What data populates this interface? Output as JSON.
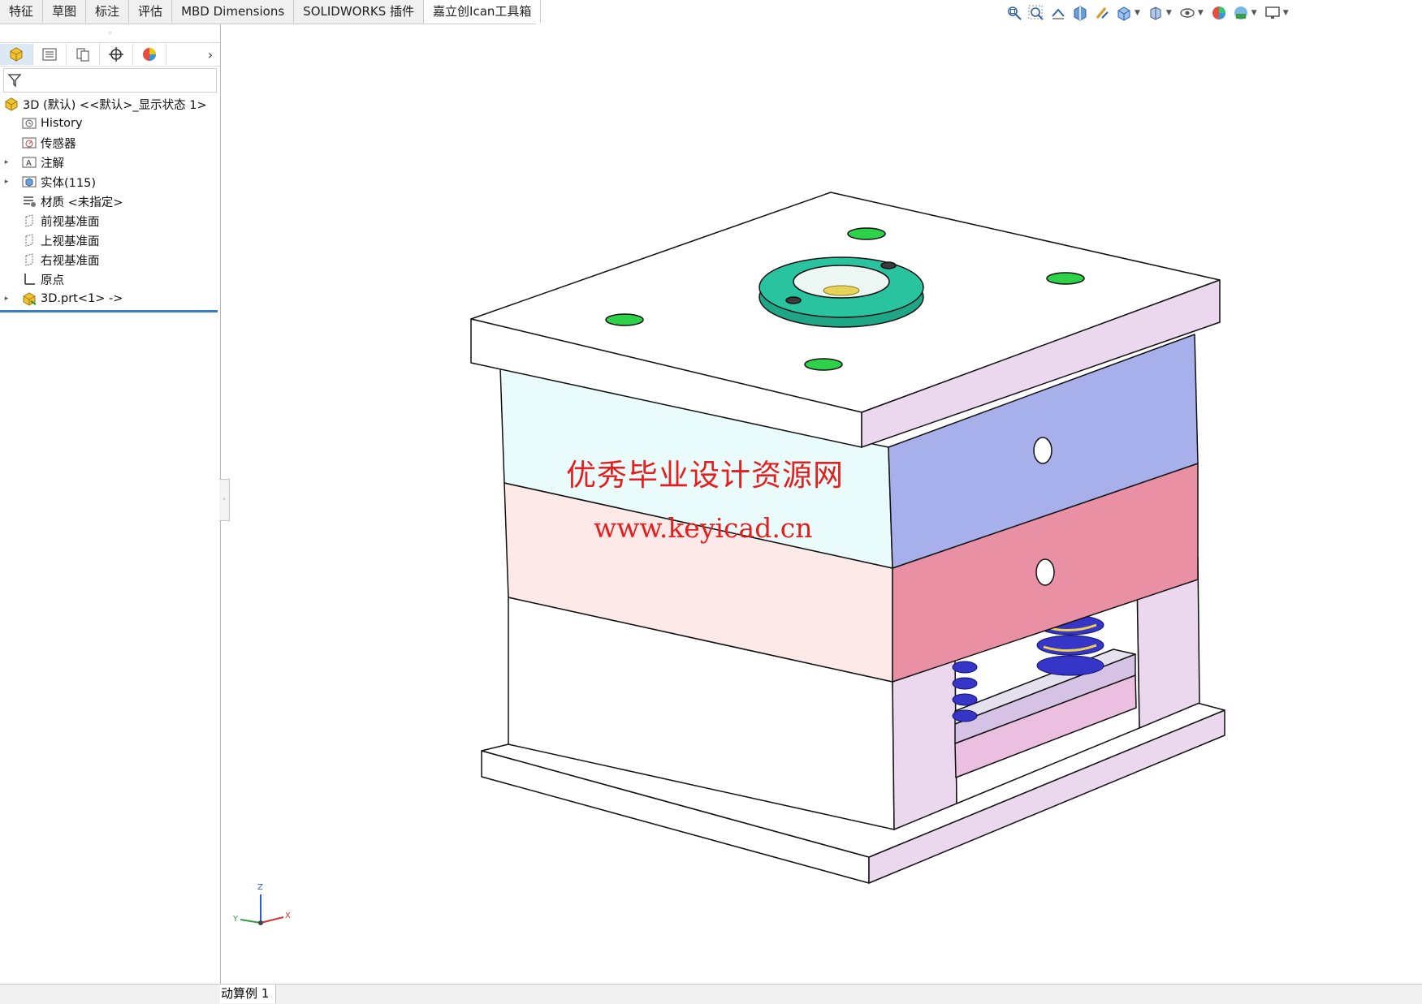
{
  "tabs": [
    {
      "label": "特征"
    },
    {
      "label": "草图"
    },
    {
      "label": "标注"
    },
    {
      "label": "评估"
    },
    {
      "label": "MBD Dimensions"
    },
    {
      "label": "SOLIDWORKS 插件"
    },
    {
      "label": "嘉立创Ican工具箱"
    }
  ],
  "view_toolbar": {
    "icons": [
      "zoom-to-fit-icon",
      "zoom-to-area-icon",
      "previous-view-icon",
      "section-view-icon",
      "dynamic-annotation-icon",
      "view-orientation-icon",
      "display-style-icon",
      "hide-show-items-icon",
      "edit-appearance-icon",
      "apply-scene-icon",
      "view-settings-icon"
    ]
  },
  "feature_tree": {
    "root": "3D (默认) <<默认>_显示状态 1>",
    "items": [
      {
        "label": "History",
        "icon": "history-icon",
        "expandable": false
      },
      {
        "label": "传感器",
        "icon": "sensor-icon",
        "expandable": false
      },
      {
        "label": "注解",
        "icon": "annotation-icon",
        "expandable": true
      },
      {
        "label": "实体(115)",
        "icon": "solid-bodies-icon",
        "expandable": true
      },
      {
        "label": "材质 <未指定>",
        "icon": "material-icon",
        "expandable": false
      },
      {
        "label": "前视基准面",
        "icon": "plane-icon",
        "expandable": false
      },
      {
        "label": "上视基准面",
        "icon": "plane-icon",
        "expandable": false
      },
      {
        "label": "右视基准面",
        "icon": "plane-icon",
        "expandable": false
      },
      {
        "label": "原点",
        "icon": "origin-icon",
        "expandable": false
      },
      {
        "label": "3D.prt<1> ->",
        "icon": "part-icon",
        "expandable": true
      }
    ]
  },
  "viewport": {
    "watermark_title": "优秀毕业设计资源网",
    "watermark_url": "www.keyicad.cn",
    "triad": {
      "z": "Z",
      "y": "Y",
      "x": "X"
    }
  },
  "bottom_tab": {
    "label": "动算例 1"
  },
  "colors": {
    "accent": "#3a7fc4",
    "watermark": "#e41f1f",
    "plate_blue": "#a8b0ec",
    "plate_red": "#e990a4",
    "plate_cyan": "#eafbfb",
    "plate_pink": "#fde9e8",
    "plate_lilac": "#ebd6ed",
    "spring": "#3535c8",
    "sprue_bushing": "#2ac3a0"
  }
}
